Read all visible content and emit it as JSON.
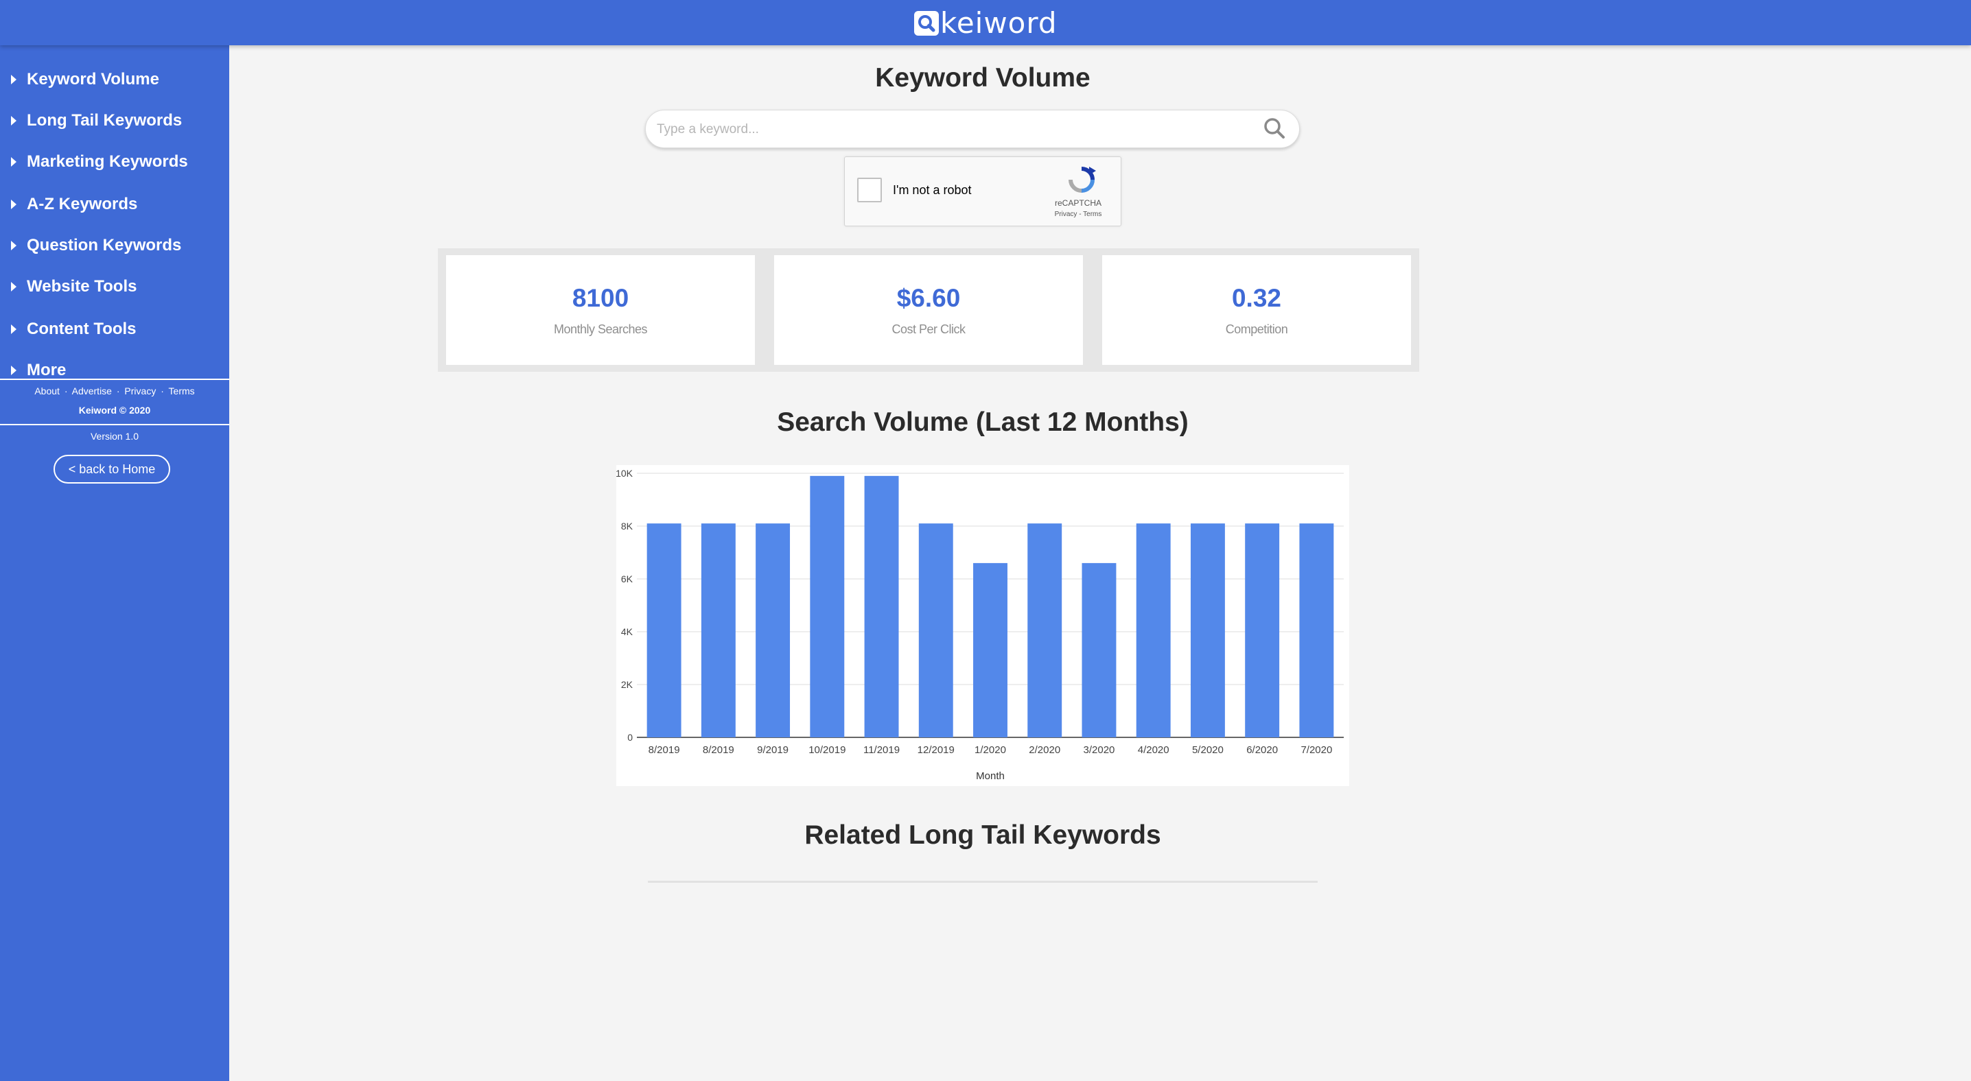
{
  "brand": {
    "name": "keiword",
    "icon": "search-icon"
  },
  "sidebar": {
    "items": [
      {
        "label": "Keyword Volume"
      },
      {
        "label": "Long Tail Keywords"
      },
      {
        "label": "Marketing Keywords"
      },
      {
        "label": "A-Z Keywords"
      },
      {
        "label": "Question Keywords"
      },
      {
        "label": "Website Tools"
      },
      {
        "label": "Content Tools"
      },
      {
        "label": "More"
      }
    ],
    "footer_links": [
      "About",
      "Advertise",
      "Privacy",
      "Terms"
    ],
    "link_separator": "·",
    "copyright": "Keiword © 2020",
    "version": "Version 1.0",
    "back_button": "< back to Home"
  },
  "main": {
    "title": "Keyword Volume",
    "search": {
      "placeholder": "Type a keyword...",
      "value": ""
    },
    "captcha": {
      "label": "I'm not a robot",
      "brand": "reCAPTCHA",
      "privacy": "Privacy",
      "separator": "-",
      "terms": "Terms"
    },
    "stats": [
      {
        "value": "8100",
        "label": "Monthly Searches"
      },
      {
        "value": "$6.60",
        "label": "Cost Per Click"
      },
      {
        "value": "0.32",
        "label": "Competition"
      }
    ],
    "chart_title": "Search Volume (Last 12 Months)",
    "related_title": "Related Long Tail Keywords"
  },
  "colors": {
    "primary": "#3f6ad6",
    "bar": "#5388ea",
    "background": "#f4f4f4"
  },
  "chart_data": {
    "type": "bar",
    "categories": [
      "8/2019",
      "8/2019",
      "9/2019",
      "10/2019",
      "11/2019",
      "12/2019",
      "1/2020",
      "2/2020",
      "3/2020",
      "4/2020",
      "5/2020",
      "6/2020",
      "7/2020"
    ],
    "values": [
      8100,
      8100,
      8100,
      9900,
      9900,
      8100,
      6600,
      8100,
      6600,
      8100,
      8100,
      8100,
      8100
    ],
    "xlabel": "Month",
    "ylabel": "",
    "ylim": [
      0,
      10000
    ],
    "yticks": [
      {
        "value": 0,
        "label": "0"
      },
      {
        "value": 2000,
        "label": "2K"
      },
      {
        "value": 4000,
        "label": "4K"
      },
      {
        "value": 6000,
        "label": "6K"
      },
      {
        "value": 8000,
        "label": "8K"
      },
      {
        "value": 10000,
        "label": "10K"
      }
    ],
    "grid": true
  }
}
